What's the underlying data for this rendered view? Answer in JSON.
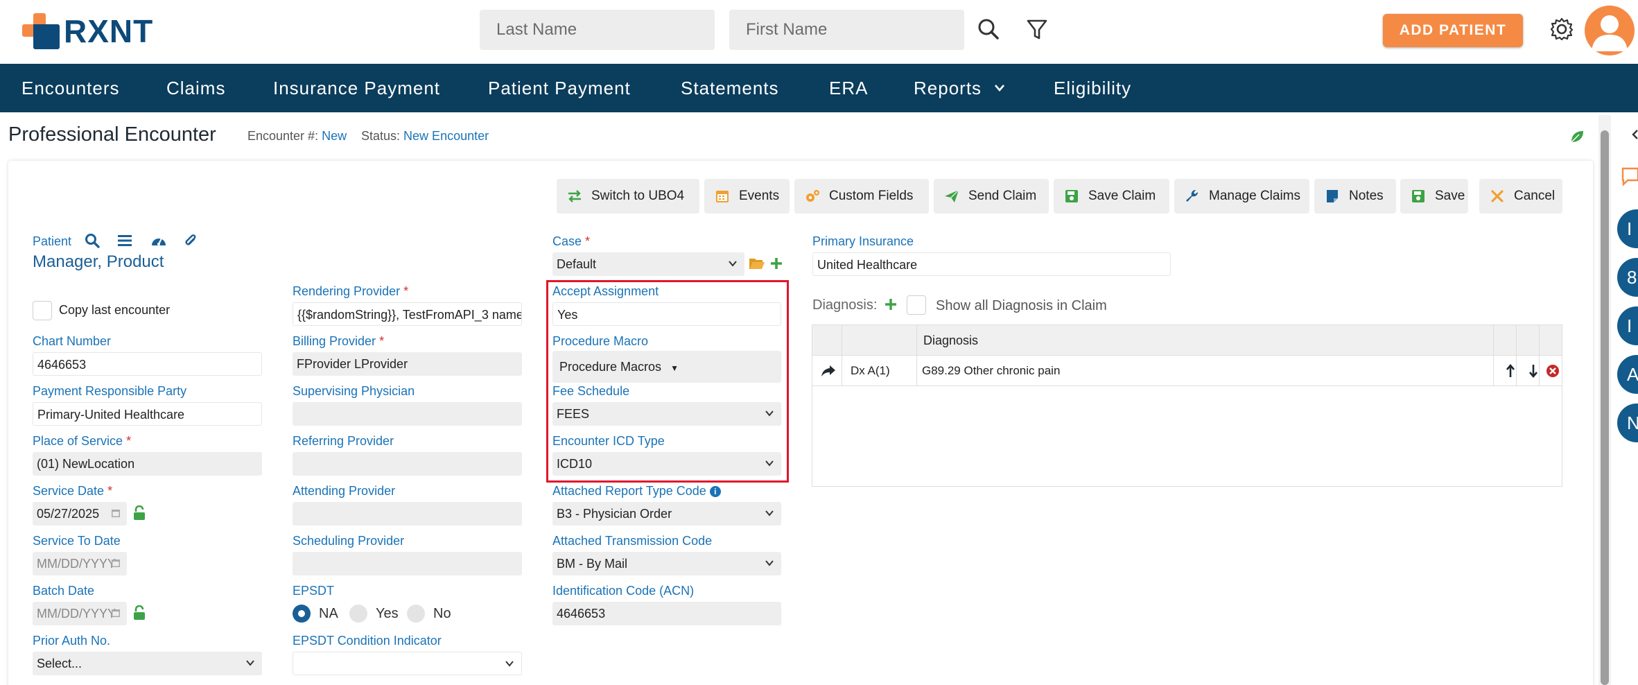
{
  "app": {
    "brand": "RXNT",
    "colors": {
      "brand_orange": "#f58a45",
      "brand_navy": "#0b3d5c",
      "link_blue": "#1a73b8",
      "highlight_red": "#e0162b",
      "success_green": "#3da346"
    }
  },
  "header": {
    "last_name_placeholder": "Last Name",
    "first_name_placeholder": "First Name",
    "search_icon": "search-icon",
    "filter_icon": "filter-icon",
    "add_patient_label": "ADD PATIENT",
    "settings_icon": "gear-icon",
    "avatar_icon": "user-avatar-icon"
  },
  "nav": {
    "items": [
      {
        "label": "Encounters"
      },
      {
        "label": "Claims"
      },
      {
        "label": "Insurance Payment"
      },
      {
        "label": "Patient Payment"
      },
      {
        "label": "Statements"
      },
      {
        "label": "ERA"
      },
      {
        "label": "Reports"
      },
      {
        "label": "Eligibility"
      }
    ]
  },
  "page": {
    "title": "Professional Encounter",
    "encounter_num_label": "Encounter #:",
    "encounter_num_value": "New",
    "status_label": "Status:",
    "status_value": "New Encounter"
  },
  "toolbar": {
    "buttons": [
      {
        "label": "Switch to UBO4",
        "icon": "switch-arrows-icon"
      },
      {
        "label": "Events",
        "icon": "calendar-icon"
      },
      {
        "label": "Custom Fields",
        "icon": "gears-icon"
      },
      {
        "label": "Send Claim",
        "icon": "paper-plane-icon"
      },
      {
        "label": "Save Claim",
        "icon": "floppy-icon"
      },
      {
        "label": "Manage Claims",
        "icon": "wrench-icon"
      },
      {
        "label": "Notes",
        "icon": "note-icon"
      },
      {
        "label": "Save",
        "icon": "floppy-icon"
      },
      {
        "label": "Cancel",
        "icon": "x-icon"
      }
    ]
  },
  "patient": {
    "label": "Patient",
    "name": "Manager, Product",
    "copy_last_encounter": "Copy last encounter"
  },
  "col1": {
    "chart_number": {
      "label": "Chart Number",
      "value": "4646653"
    },
    "payment_party": {
      "label": "Payment Responsible Party",
      "value": "Primary-United Healthcare"
    },
    "place_of_service": {
      "label": "Place of Service",
      "value": "(01) NewLocation"
    },
    "service_date": {
      "label": "Service Date",
      "value": "05/27/2025"
    },
    "service_to_date": {
      "label": "Service To Date",
      "placeholder": "MM/DD/YYYY"
    },
    "batch_date": {
      "label": "Batch Date",
      "placeholder": "MM/DD/YYYY"
    },
    "prior_auth": {
      "label": "Prior Auth No.",
      "value": "Select..."
    }
  },
  "col2": {
    "rendering_provider": {
      "label": "Rendering Provider",
      "value": "{{$randomString}}, TestFromAPI_3 name"
    },
    "billing_provider": {
      "label": "Billing Provider",
      "value": "FProvider LProvider"
    },
    "supervising_physician": {
      "label": "Supervising Physician",
      "value": ""
    },
    "referring_provider": {
      "label": "Referring Provider",
      "value": ""
    },
    "attending_provider": {
      "label": "Attending Provider",
      "value": ""
    },
    "scheduling_provider": {
      "label": "Scheduling Provider",
      "value": ""
    },
    "epsdt": {
      "label": "EPSDT",
      "options": [
        "NA",
        "Yes",
        "No"
      ],
      "selected": "NA"
    },
    "epsdt_condition": {
      "label": "EPSDT Condition Indicator",
      "value": ""
    }
  },
  "col3": {
    "case": {
      "label": "Case",
      "value": "Default"
    },
    "accept_assignment": {
      "label": "Accept Assignment",
      "value": "Yes"
    },
    "procedure_macro": {
      "label": "Procedure Macro",
      "value": "Procedure Macros"
    },
    "fee_schedule": {
      "label": "Fee Schedule",
      "value": "FEES"
    },
    "icd_type": {
      "label": "Encounter ICD Type",
      "value": "ICD10"
    },
    "report_type_code": {
      "label": "Attached Report Type Code",
      "value": "B3 - Physician Order"
    },
    "transmission_code": {
      "label": "Attached Transmission Code",
      "value": "BM - By Mail"
    },
    "acn": {
      "label": "Identification Code (ACN)",
      "value": "4646653"
    }
  },
  "col4": {
    "primary_insurance": {
      "label": "Primary Insurance",
      "value": "United Healthcare"
    },
    "diagnosis_label": "Diagnosis:",
    "show_all_label": "Show all Diagnosis in Claim",
    "table_header": "Diagnosis",
    "rows": [
      {
        "pointer": "Dx A(1)",
        "diagnosis": "G89.29 Other chronic pain"
      }
    ]
  },
  "sidebar": {
    "circles": [
      "I",
      "8",
      "I",
      "A",
      "N"
    ]
  }
}
